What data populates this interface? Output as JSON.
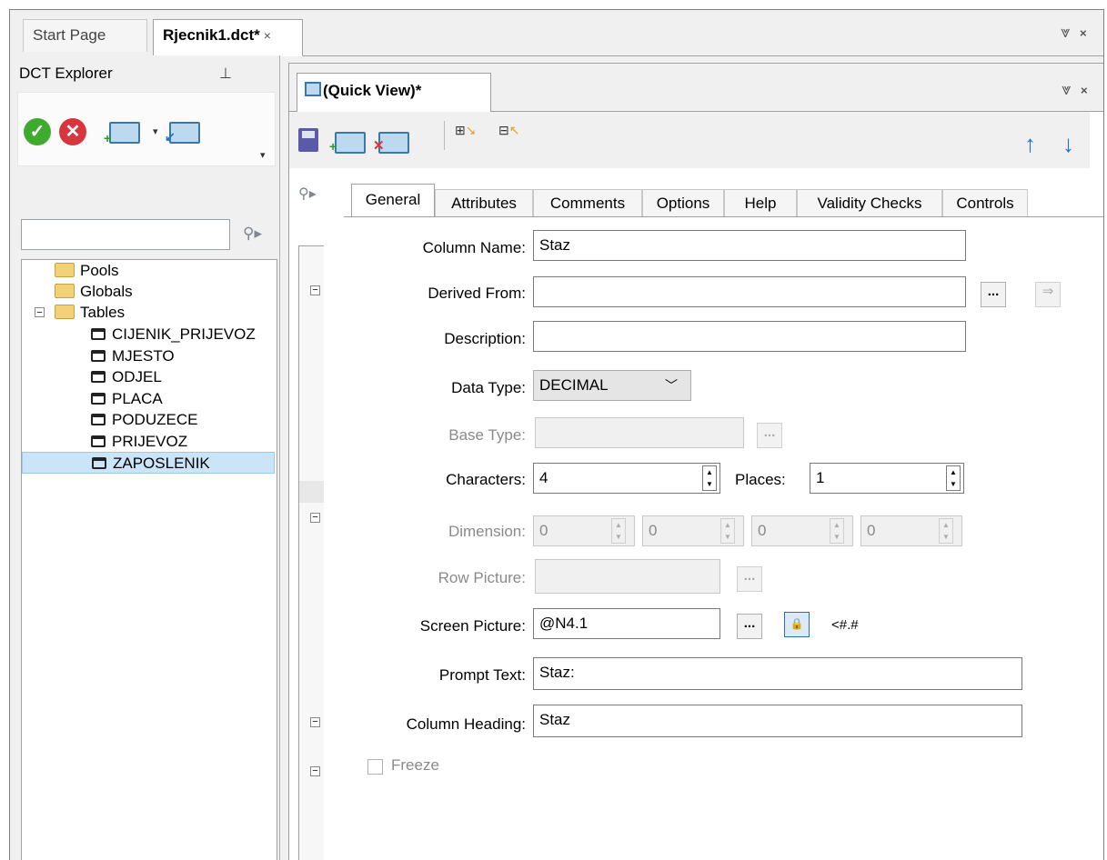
{
  "doc_tabs": {
    "start": "Start Page",
    "active": "Rjecnik1.dct*",
    "close": "×",
    "window_buttons": "⩔ ⨯"
  },
  "explorer": {
    "title": "DCT Explorer",
    "pin": "⊥",
    "tree": {
      "pools": "Pools",
      "globals": "Globals",
      "tables": "Tables",
      "table_items": [
        "CIJENIK_PRIJEVOZ",
        "MJESTO",
        "ODJEL",
        "PLACA",
        "PODUZECE",
        "PRIJEVOZ",
        "ZAPOSLENIK"
      ],
      "selected": "ZAPOSLENIK"
    }
  },
  "quick_view": {
    "tab_label": "(Quick View)*",
    "tabs": [
      "General",
      "Attributes",
      "Comments",
      "Options",
      "Help",
      "Validity Checks",
      "Controls"
    ],
    "active_tab": "General"
  },
  "form": {
    "column_name": {
      "label": "Column Name:",
      "value": "Staz"
    },
    "derived_from": {
      "label": "Derived From:",
      "value": ""
    },
    "description": {
      "label": "Description:",
      "value": ""
    },
    "data_type": {
      "label": "Data Type:",
      "value": "DECIMAL"
    },
    "base_type": {
      "label": "Base Type:",
      "value": ""
    },
    "characters": {
      "label": "Characters:",
      "value": "4"
    },
    "places": {
      "label": "Places:",
      "value": "1"
    },
    "dimension": {
      "label": "Dimension:",
      "values": [
        "0",
        "0",
        "0",
        "0"
      ]
    },
    "row_picture": {
      "label": "Row Picture:",
      "value": ""
    },
    "screen_picture": {
      "label": "Screen Picture:",
      "value": "@N4.1",
      "preview": "<#.#"
    },
    "prompt_text": {
      "label": "Prompt Text:",
      "value": "Staz:"
    },
    "column_heading": {
      "label": "Column Heading:",
      "value": "Staz"
    },
    "freeze": {
      "label": "Freeze",
      "checked": false
    },
    "ellipsis": "..."
  }
}
